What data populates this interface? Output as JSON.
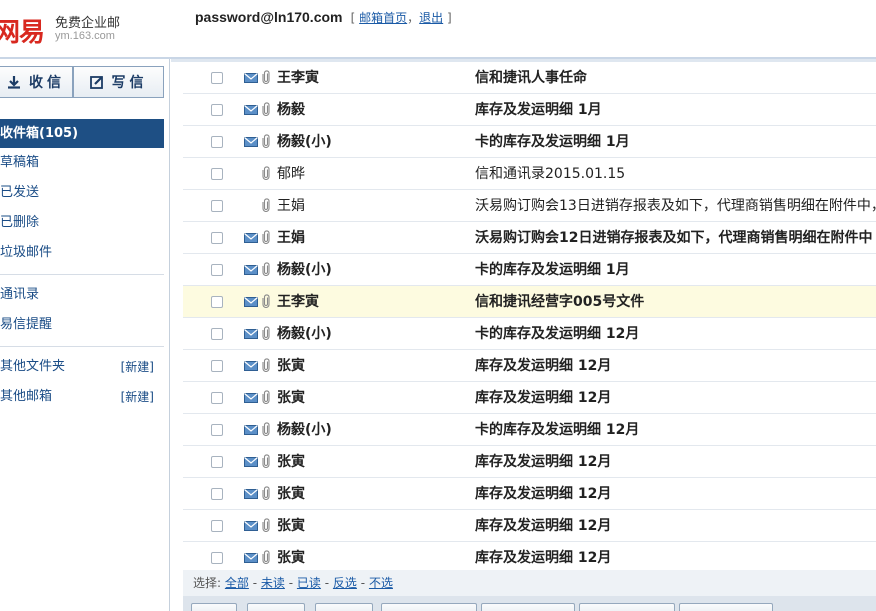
{
  "logo": {
    "mark": "网易",
    "text": "免费企业邮",
    "sub": "ym.163.com"
  },
  "user": {
    "email": "password@ln170.com",
    "bracket_open": "[",
    "home_link": "邮箱首页",
    "separator": "，",
    "logout_link": "退出",
    "bracket_close": "]"
  },
  "actions": {
    "receive_label": "收信",
    "compose_label": "写信"
  },
  "folders": [
    {
      "label": "收件箱(105)",
      "active": true
    },
    {
      "label": "草稿箱"
    },
    {
      "label": "已发送"
    },
    {
      "label": "已删除"
    },
    {
      "label": "垃圾邮件"
    }
  ],
  "tools": [
    {
      "label": "通讯录"
    },
    {
      "label": "易信提醒"
    }
  ],
  "other": [
    {
      "label": "其他文件夹",
      "new_label": "[新建]"
    },
    {
      "label": "其他邮箱",
      "new_label": "[新建]"
    }
  ],
  "mails": [
    {
      "sender": "王李寅",
      "subject": "信和捷讯人事任命",
      "unread": true,
      "envelope": true,
      "attachment": true
    },
    {
      "sender": "杨毅",
      "subject": "库存及发运明细 1月",
      "unread": true,
      "envelope": true,
      "attachment": true
    },
    {
      "sender": "杨毅(小)",
      "subject": "卡的库存及发运明细 1月",
      "unread": true,
      "envelope": true,
      "attachment": true
    },
    {
      "sender": "郁晔",
      "subject": "信和通讯录2015.01.15",
      "unread": false,
      "envelope": false,
      "attachment": true
    },
    {
      "sender": "王娟",
      "subject": "沃易购订购会13日进销存报表及如下，代理商销售明细在附件中，",
      "unread": false,
      "envelope": false,
      "attachment": true
    },
    {
      "sender": "王娟",
      "subject": "沃易购订购会12日进销存报表及如下，代理商销售明细在附件中",
      "unread": true,
      "envelope": true,
      "attachment": true
    },
    {
      "sender": "杨毅(小)",
      "subject": "卡的库存及发运明细 1月",
      "unread": true,
      "envelope": true,
      "attachment": true
    },
    {
      "sender": "王李寅",
      "subject": "信和捷讯经营字005号文件",
      "unread": true,
      "envelope": true,
      "attachment": true,
      "highlight": true
    },
    {
      "sender": "杨毅(小)",
      "subject": "卡的库存及发运明细 12月",
      "unread": true,
      "envelope": true,
      "attachment": true
    },
    {
      "sender": "张寅",
      "subject": "库存及发运明细 12月",
      "unread": true,
      "envelope": true,
      "attachment": true
    },
    {
      "sender": "张寅",
      "subject": "库存及发运明细 12月",
      "unread": true,
      "envelope": true,
      "attachment": true
    },
    {
      "sender": "杨毅(小)",
      "subject": "卡的库存及发运明细 12月",
      "unread": true,
      "envelope": true,
      "attachment": true
    },
    {
      "sender": "张寅",
      "subject": "库存及发运明细 12月",
      "unread": true,
      "envelope": true,
      "attachment": true
    },
    {
      "sender": "张寅",
      "subject": "库存及发运明细 12月",
      "unread": true,
      "envelope": true,
      "attachment": true
    },
    {
      "sender": "张寅",
      "subject": "库存及发运明细 12月",
      "unread": true,
      "envelope": true,
      "attachment": true
    },
    {
      "sender": "张寅",
      "subject": "库存及发运明细 12月",
      "unread": true,
      "envelope": true,
      "attachment": true
    }
  ],
  "select_bar": {
    "prefix": "选择:",
    "all": "全部",
    "unread": "未读",
    "read": "已读",
    "invert": "反选",
    "none": "不选",
    "dash": "-"
  },
  "colors": {
    "accent": "#1e4f84",
    "brand_red": "#d8281f",
    "link": "#1a5aa6",
    "highlight_row": "#fdfbe0"
  }
}
